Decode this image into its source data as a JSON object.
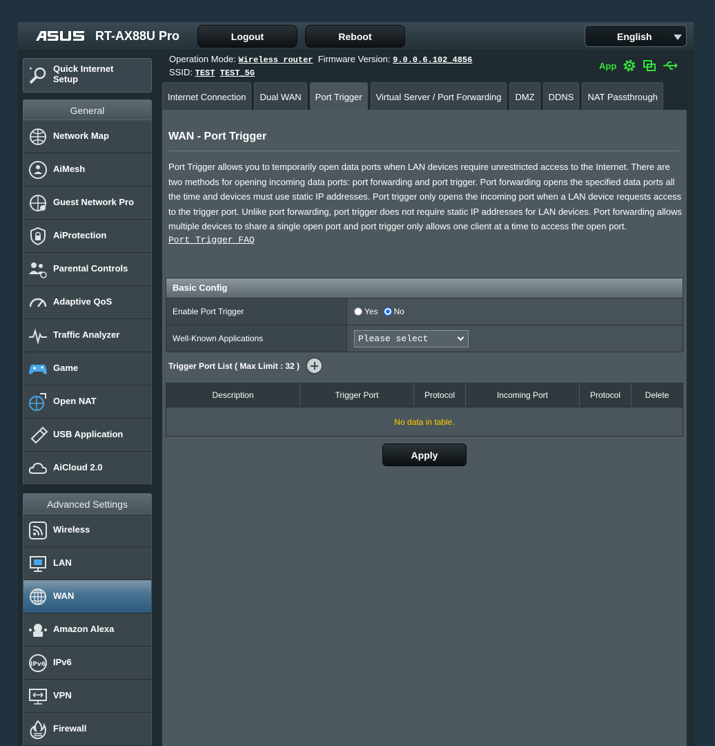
{
  "header": {
    "brand": "ASUS",
    "model": "RT-AX88U Pro",
    "logout_label": "Logout",
    "reboot_label": "Reboot",
    "language": "English"
  },
  "info": {
    "op_mode_label": "Operation Mode:",
    "op_mode_value": "Wireless router",
    "firmware_label": "Firmware Version:",
    "firmware_value": "9.0.0.6.102_4856",
    "ssid_label": "SSID:",
    "ssid_1": "TEST",
    "ssid_2": "TEST_5G",
    "app_label": "App",
    "icons": [
      "gear-icon",
      "devices-icon",
      "usb-icon"
    ],
    "accent_color": "#33e23a"
  },
  "nav": {
    "qis_label": "Quick Internet Setup",
    "general_title": "General",
    "general_items": [
      {
        "label": "Network Map",
        "icon": "network-map-icon"
      },
      {
        "label": "AiMesh",
        "icon": "aimesh-icon"
      },
      {
        "label": "Guest Network Pro",
        "icon": "guest-network-icon"
      },
      {
        "label": "AiProtection",
        "icon": "shield-lock-icon"
      },
      {
        "label": "Parental Controls",
        "icon": "parental-icon"
      },
      {
        "label": "Adaptive QoS",
        "icon": "gauge-icon"
      },
      {
        "label": "Traffic Analyzer",
        "icon": "pulse-icon"
      },
      {
        "label": "Game",
        "icon": "gamepad-icon"
      },
      {
        "label": "Open NAT",
        "icon": "open-nat-icon"
      },
      {
        "label": "USB Application",
        "icon": "usb-stick-icon"
      },
      {
        "label": "AiCloud 2.0",
        "icon": "cloud-icon"
      }
    ],
    "advanced_title": "Advanced Settings",
    "advanced_items": [
      {
        "label": "Wireless",
        "icon": "wifi-icon"
      },
      {
        "label": "LAN",
        "icon": "lan-icon"
      },
      {
        "label": "WAN",
        "icon": "globe-icon",
        "active": true
      },
      {
        "label": "Amazon Alexa",
        "icon": "alexa-icon"
      },
      {
        "label": "IPv6",
        "icon": "ipv6-icon"
      },
      {
        "label": "VPN",
        "icon": "vpn-icon"
      },
      {
        "label": "Firewall",
        "icon": "firewall-icon"
      }
    ]
  },
  "tabs": [
    {
      "label": "Internet Connection"
    },
    {
      "label": "Dual WAN"
    },
    {
      "label": "Port Trigger",
      "active": true
    },
    {
      "label": "Virtual Server / Port Forwarding"
    },
    {
      "label": "DMZ"
    },
    {
      "label": "DDNS"
    },
    {
      "label": "NAT Passthrough"
    }
  ],
  "page": {
    "title": "WAN - Port Trigger",
    "description": "Port Trigger allows you to temporarily open data ports when LAN devices require unrestricted access to the Internet. There are two methods for opening incoming data ports: port forwarding and port trigger. Port forwarding opens the specified data ports all the time and devices must use static IP addresses. Port trigger only opens the incoming port when a LAN device requests access to the trigger port. Unlike port forwarding, port trigger does not require static IP addresses for LAN devices. Port forwarding allows multiple devices to share a single open port and port trigger only allows one client at a time to access the open port.",
    "faq_link": "Port Trigger FAQ"
  },
  "basic_config": {
    "title": "Basic Config",
    "enable_label": "Enable Port Trigger",
    "yes_label": "Yes",
    "no_label": "No",
    "enabled": "No",
    "apps_label": "Well-Known Applications",
    "apps_value": "Please select"
  },
  "trigger_list": {
    "title": "Trigger Port List ( Max Limit : 32 )",
    "columns": [
      "Description",
      "Trigger Port",
      "Protocol",
      "Incoming Port",
      "Protocol",
      "Delete"
    ],
    "empty_text": "No data in table.",
    "empty_color": "#ffcc00"
  },
  "apply_label": "Apply"
}
